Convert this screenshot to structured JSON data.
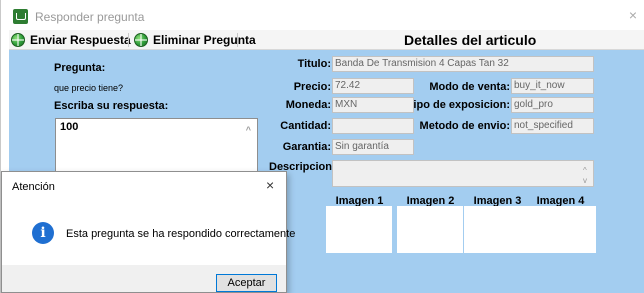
{
  "window": {
    "title": "Responder pregunta",
    "close_glyph": "×",
    "icon": "cart-icon"
  },
  "toolbar": {
    "send_label": "Enviar Respuesta",
    "delete_label": "Eliminar Pregunta",
    "button_icon": "globe-icon"
  },
  "header": {
    "title": "Detalles del articulo"
  },
  "question": {
    "label": "Pregunta:",
    "text": "que precio tiene?",
    "answer_label": "Escriba su respuesta:",
    "answer_value": "100",
    "scroll_glyph": "^"
  },
  "article": {
    "title_label": "Titulo:",
    "title_value": "Banda De Transmision 4 Capas Tan  32",
    "price_label": "Precio:",
    "price_value": "72.42",
    "sale_mode_label": "Modo de venta:",
    "sale_mode_value": "buy_it_now",
    "currency_label": "Moneda:",
    "currency_value": "MXN",
    "exposure_label": "Tipo de exposicion:",
    "exposure_value": "gold_pro",
    "quantity_label": "Cantidad:",
    "quantity_value": "",
    "shipping_label": "Metodo de envio:",
    "shipping_value": "not_specified",
    "warranty_label": "Garantia:",
    "warranty_value": "Sin garantía",
    "description_label": "Descripcion:",
    "description_value": "",
    "scroll_up_glyph": "^",
    "scroll_down_glyph": "v"
  },
  "images": {
    "labels": [
      "Imagen 1",
      "Imagen 2",
      "Imagen 3",
      "Imagen 4"
    ]
  },
  "dialog": {
    "title": "Atención",
    "close_glyph": "×",
    "info_glyph": "i",
    "message": "Esta pregunta se ha respondido correctamente",
    "ok_label": "Aceptar"
  },
  "colors": {
    "panel_background": "#a3cdf0",
    "info_icon": "#1f6fd1",
    "button_focus_border": "#0078d7"
  }
}
